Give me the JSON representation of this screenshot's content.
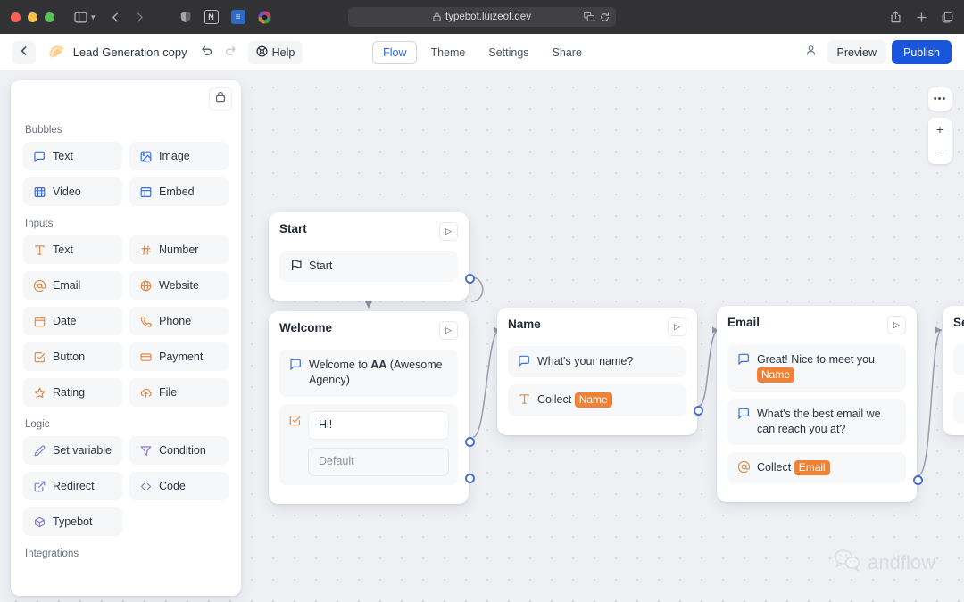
{
  "browser": {
    "url": "typebot.luizeof.dev",
    "lock_icon": "lock-icon",
    "traffic_lights": [
      "close",
      "minimize",
      "maximize"
    ],
    "extensions": [
      "shield-icon",
      "notion-icon",
      "bookmark-icon",
      "colorwheel-icon"
    ],
    "translate_icon": "translate-icon",
    "reload_icon": "reload-icon",
    "share_icon": "share-icon",
    "newtab_icon": "plus-icon",
    "tabs_icon": "tabs-icon"
  },
  "appbar": {
    "back_icon": "chevron-left-icon",
    "bot_emoji": "🥟",
    "bot_name": "Lead Generation copy",
    "undo_icon": "undo-icon",
    "redo_icon": "redo-icon",
    "help_label": "Help",
    "help_icon": "help-icon",
    "tabs": [
      {
        "label": "Flow",
        "active": true
      },
      {
        "label": "Theme",
        "active": false
      },
      {
        "label": "Settings",
        "active": false
      },
      {
        "label": "Share",
        "active": false
      }
    ],
    "collaborators_icon": "users-icon",
    "preview_label": "Preview",
    "publish_label": "Publish",
    "publish_color": "#1a56db"
  },
  "sidebar": {
    "lock_icon": "lock-icon",
    "sections": [
      {
        "label": "Bubbles",
        "color": "#3f6fd8",
        "items": [
          {
            "label": "Text",
            "icon": "message-square-icon"
          },
          {
            "label": "Image",
            "icon": "image-icon"
          },
          {
            "label": "Video",
            "icon": "film-icon"
          },
          {
            "label": "Embed",
            "icon": "layout-icon"
          }
        ]
      },
      {
        "label": "Inputs",
        "color": "#e08a4a",
        "items": [
          {
            "label": "Text",
            "icon": "type-icon"
          },
          {
            "label": "Number",
            "icon": "hash-icon"
          },
          {
            "label": "Email",
            "icon": "at-sign-icon"
          },
          {
            "label": "Website",
            "icon": "globe-icon"
          },
          {
            "label": "Date",
            "icon": "calendar-icon"
          },
          {
            "label": "Phone",
            "icon": "phone-icon"
          },
          {
            "label": "Button",
            "icon": "check-square-icon"
          },
          {
            "label": "Payment",
            "icon": "credit-card-icon"
          },
          {
            "label": "Rating",
            "icon": "star-icon"
          },
          {
            "label": "File",
            "icon": "upload-cloud-icon"
          }
        ]
      },
      {
        "label": "Logic",
        "color": "#8a79cf",
        "items": [
          {
            "label": "Set variable",
            "icon": "pencil-icon"
          },
          {
            "label": "Condition",
            "icon": "filter-icon"
          },
          {
            "label": "Redirect",
            "icon": "external-link-icon"
          },
          {
            "label": "Code",
            "icon": "code-icon"
          },
          {
            "label": "Typebot",
            "icon": "box-icon"
          }
        ]
      },
      {
        "label": "Integrations",
        "color": "#6a7280",
        "items": []
      }
    ]
  },
  "canvas": {
    "controls": {
      "more_icon": "ellipsis-icon",
      "zoom_in_label": "+",
      "zoom_out_label": "−"
    },
    "watermark": {
      "icon": "wechat-icon",
      "text": "andflow"
    },
    "groups": [
      {
        "title": "Start",
        "play_icon": "play-icon",
        "blocks": [
          {
            "type": "start",
            "icon": "flag-icon",
            "icon_color": "#2b3340",
            "text": "Start"
          }
        ]
      },
      {
        "title": "Welcome",
        "play_icon": "play-icon",
        "blocks": [
          {
            "type": "bubble",
            "icon": "message-square-icon",
            "icon_color": "#3f6fd8",
            "text_parts": [
              {
                "t": "Welcome to ",
                "b": false
              },
              {
                "t": "AA",
                "b": true
              },
              {
                "t": " (Awesome Agency)",
                "b": false
              }
            ]
          },
          {
            "type": "buttons",
            "icon": "check-square-icon",
            "icon_color": "#e08a4a",
            "items": [
              "Hi!"
            ],
            "default_label": "Default"
          }
        ]
      },
      {
        "title": "Name",
        "play_icon": "play-icon",
        "blocks": [
          {
            "type": "bubble",
            "icon": "message-square-icon",
            "icon_color": "#3f6fd8",
            "text": "What's your name?"
          },
          {
            "type": "input",
            "icon": "type-icon",
            "icon_color": "#e08a4a",
            "prefix": "Collect ",
            "variable": "Name"
          }
        ]
      },
      {
        "title": "Email",
        "play_icon": "play-icon",
        "blocks": [
          {
            "type": "bubble",
            "icon": "message-square-icon",
            "icon_color": "#3f6fd8",
            "prefix": "Great! Nice to meet you ",
            "variable": "Name"
          },
          {
            "type": "bubble",
            "icon": "message-square-icon",
            "icon_color": "#3f6fd8",
            "text": "What's the best email we can reach you at?"
          },
          {
            "type": "input",
            "icon": "at-sign-icon",
            "icon_color": "#e08a4a",
            "prefix": "Collect ",
            "variable": "Email"
          }
        ]
      },
      {
        "title": "Se",
        "partial": true,
        "play_icon": "play-icon",
        "blocks": [
          {
            "type": "bubble",
            "icon": "message-square-icon",
            "icon_color": "#3f6fd8",
            "text": ""
          },
          {
            "type": "input",
            "icon": "check-square-icon",
            "icon_color": "#e08a4a",
            "text": ""
          }
        ]
      }
    ]
  },
  "colors": {
    "variable_tag": "#f08237",
    "accent_blue": "#1a56db",
    "handle_blue": "#4a6fd0",
    "canvas_bg": "#eef0f4"
  }
}
